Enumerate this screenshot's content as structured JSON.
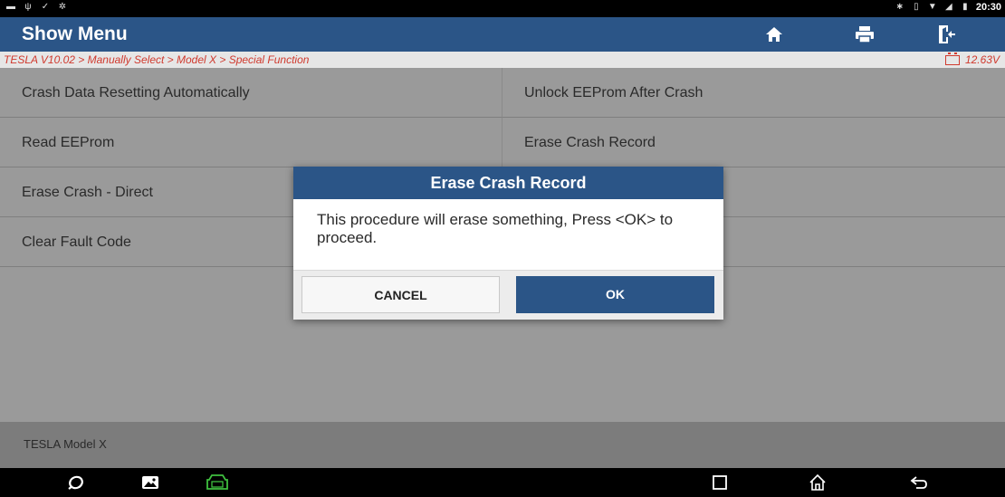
{
  "status": {
    "time": "20:30",
    "left_icons": [
      "image-icon",
      "usb-icon",
      "check-icon",
      "settings-icon"
    ],
    "right_icons": [
      "bluetooth-icon",
      "vibrate-icon",
      "wifi-icon",
      "signal-icon",
      "battery-icon"
    ]
  },
  "header": {
    "title": "Show Menu",
    "home_icon": "home-icon",
    "print_icon": "print-icon",
    "exit_icon": "exit-icon"
  },
  "path": {
    "breadcrumb": "TESLA V10.02 > Manually Select > Model X > Special Function",
    "voltage": "12.63V"
  },
  "menu": {
    "items": [
      "Crash Data Resetting Automatically",
      "Unlock EEProm After Crash",
      "Read EEProm",
      "Erase Crash Record",
      "Erase Crash - Direct",
      "Clear Fault Code"
    ]
  },
  "footer": {
    "vehicle": "TESLA Model X"
  },
  "dialog": {
    "title": "Erase Crash Record",
    "message": "This procedure will erase something, Press <OK> to proceed.",
    "cancel_label": "CANCEL",
    "ok_label": "OK"
  },
  "colors": {
    "header_blue": "#2b5587",
    "path_red": "#d03a2e",
    "menu_gray": "#9a9a9a",
    "footer_gray": "#7c7c7c",
    "vci_green": "#3fbf3f"
  }
}
